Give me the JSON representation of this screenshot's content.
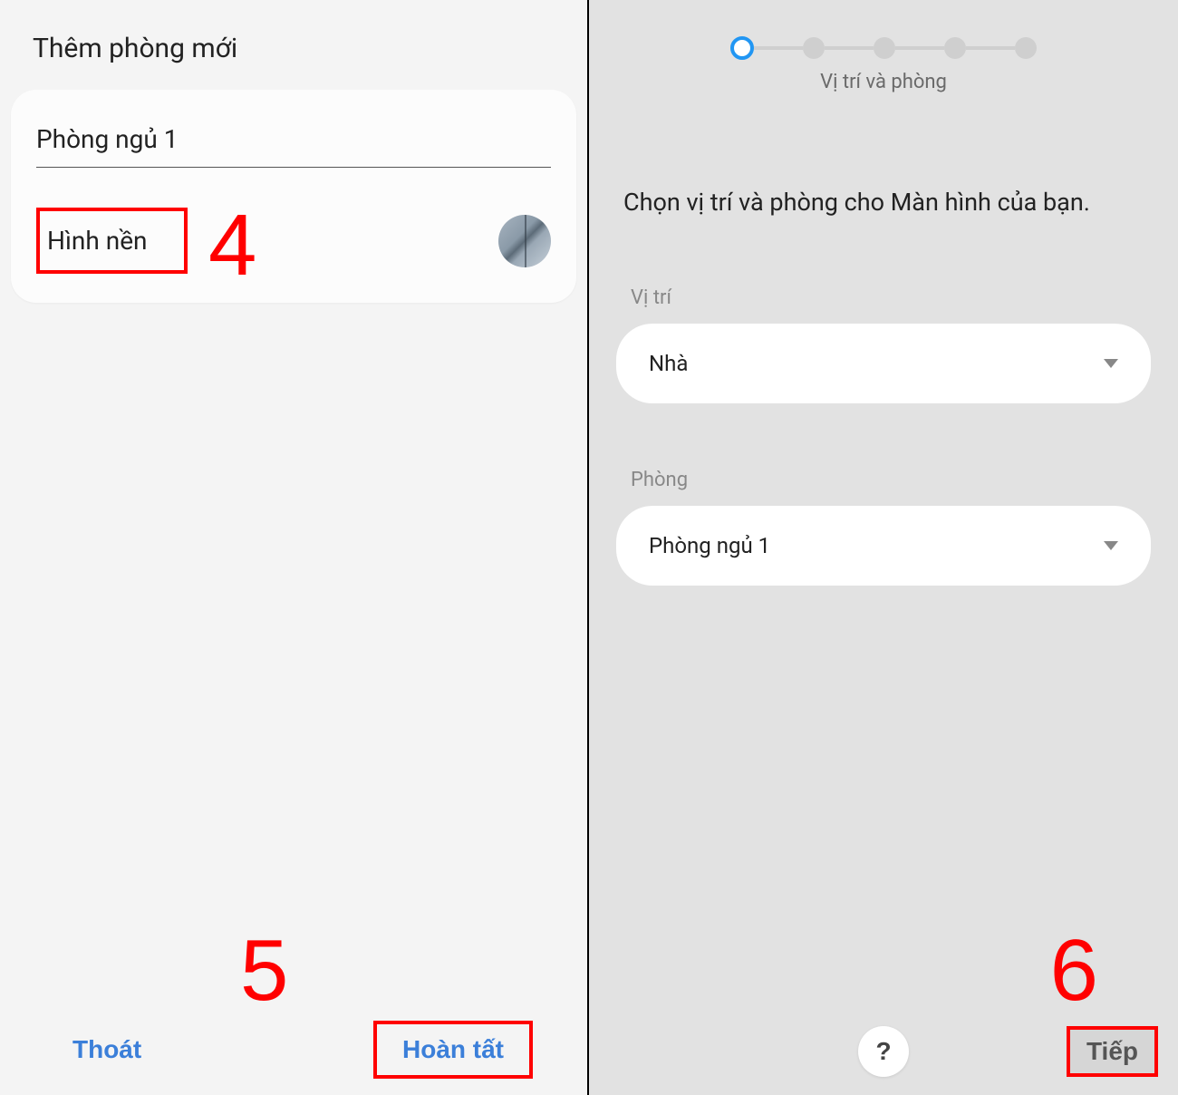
{
  "left": {
    "title": "Thêm phòng mới",
    "room_name_value": "Phòng ngủ 1",
    "wallpaper_label": "Hình nền",
    "annotation_4": "4",
    "annotation_5": "5",
    "exit_label": "Thoát",
    "done_label": "Hoàn tất"
  },
  "right": {
    "step_label": "Vị trí và phòng",
    "instruction": "Chọn vị trí và phòng cho Màn hình của bạn.",
    "location_label": "Vị trí",
    "location_value": "Nhà",
    "room_label": "Phòng",
    "room_value": "Phòng ngủ 1",
    "help_label": "?",
    "next_label": "Tiếp",
    "annotation_6": "6"
  }
}
